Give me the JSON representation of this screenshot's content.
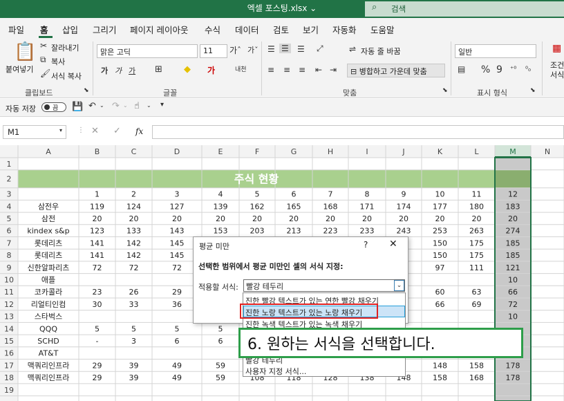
{
  "window": {
    "title": "엑셀 포스팅.xlsx ⌄",
    "search_placeholder": "검색"
  },
  "menu": [
    "파일",
    "홈",
    "삽입",
    "그리기",
    "페이지 레이아웃",
    "수식",
    "데이터",
    "검토",
    "보기",
    "자동화",
    "도움말"
  ],
  "ribbon": {
    "paste": "붙여넣기",
    "cut": "잘라내기",
    "copy": "복사",
    "format_painter": "서식 복사",
    "clipboard_group": "클립보드",
    "font_name": "맑은 고딕",
    "font_size": "11",
    "font_group": "글꼴",
    "wrap_text": "자동 줄 바꿈",
    "merge_center": "병합하고 가운데 맞춤",
    "align_group": "맞춤",
    "number_format": "일반",
    "number_group": "표시 형식",
    "conditional_1": "조건",
    "conditional_2": "서식"
  },
  "qat": {
    "autosave": "자동 저장",
    "toggle": "끔"
  },
  "formula_bar": {
    "name_box": "M1",
    "fx": "fx"
  },
  "sheet": {
    "columns": [
      "A",
      "B",
      "C",
      "D",
      "E",
      "F",
      "G",
      "H",
      "I",
      "J",
      "K",
      "L",
      "M",
      "N"
    ],
    "title": "주식 현황",
    "header_numbers": [
      "1",
      "2",
      "3",
      "4",
      "5",
      "6",
      "7",
      "8",
      "9",
      "10",
      "11",
      "12"
    ],
    "rows": [
      {
        "name": "삼전우",
        "v": [
          "119",
          "124",
          "127",
          "139",
          "162",
          "165",
          "168",
          "171",
          "174",
          "177",
          "180",
          "183"
        ]
      },
      {
        "name": "삼전",
        "v": [
          "20",
          "20",
          "20",
          "20",
          "20",
          "20",
          "20",
          "20",
          "20",
          "20",
          "20",
          "20"
        ]
      },
      {
        "name": "kindex s&p",
        "v": [
          "123",
          "133",
          "143",
          "153",
          "203",
          "213",
          "223",
          "233",
          "243",
          "253",
          "263",
          "274"
        ]
      },
      {
        "name": "롯데리츠",
        "v": [
          "141",
          "142",
          "145",
          "",
          "",
          "",
          "",
          "",
          "",
          "150",
          "175",
          "185"
        ]
      },
      {
        "name": "롯데리츠",
        "v": [
          "141",
          "142",
          "145",
          "",
          "",
          "",
          "",
          "",
          "",
          "150",
          "175",
          "185"
        ]
      },
      {
        "name": "신한알파리츠",
        "v": [
          "72",
          "72",
          "72",
          "",
          "",
          "",
          "",
          "",
          "",
          "97",
          "111",
          "121"
        ]
      },
      {
        "name": "애플",
        "v": [
          "",
          "",
          "",
          "",
          "",
          "",
          "",
          "",
          "",
          "",
          "",
          "10"
        ]
      },
      {
        "name": "코카콜라",
        "v": [
          "23",
          "26",
          "29",
          "",
          "",
          "",
          "",
          "",
          "",
          "60",
          "63",
          "66"
        ]
      },
      {
        "name": "리얼티인컴",
        "v": [
          "30",
          "33",
          "36",
          "",
          "",
          "",
          "",
          "",
          "",
          "66",
          "69",
          "72"
        ]
      },
      {
        "name": "스타벅스",
        "v": [
          "",
          "",
          "",
          "",
          "",
          "",
          "",
          "",
          "",
          "",
          "",
          "10"
        ]
      },
      {
        "name": "QQQ",
        "v": [
          "5",
          "5",
          "5",
          "5",
          "",
          "",
          "",
          "",
          "",
          "",
          "",
          ""
        ]
      },
      {
        "name": "SCHD",
        "v": [
          "-",
          "3",
          "6",
          "6",
          "",
          "",
          "",
          "",
          "",
          "",
          "",
          ""
        ]
      },
      {
        "name": "AT&T",
        "v": [
          "",
          "",
          "",
          "",
          "",
          "",
          "",
          "",
          "",
          "",
          "",
          ""
        ]
      },
      {
        "name": "맥쿼리인프라",
        "v": [
          "29",
          "39",
          "49",
          "59",
          "",
          "",
          "",
          "",
          "",
          "148",
          "158",
          "178"
        ]
      },
      {
        "name": "맥쿼리인프라",
        "v": [
          "29",
          "39",
          "49",
          "59",
          "108",
          "118",
          "128",
          "138",
          "148",
          "158",
          "168",
          "178"
        ]
      }
    ]
  },
  "dialog": {
    "title": "평균 미만",
    "help": "?",
    "close": "✕",
    "description": "선택한 범위에서 평균 미만인 셀의 서식 지정:",
    "label": "적용할 서식:",
    "selected": "빨강 테두리",
    "options": [
      "진한 빨강 텍스트가 있는 연한 빨강 채우기",
      "진한 노랑 텍스트가 있는 노랑 채우기",
      "진한 녹색 텍스트가 있는 녹색 채우기",
      "빨강 테두리",
      "사용자 지정 서식..."
    ]
  },
  "callout": "6. 원하는 서식을 선택합니다.",
  "colors": {
    "excel_green": "#217346",
    "title_fill": "#a9d08e",
    "selected_col": "#c9c9c9",
    "callout_border": "#2e9e4a"
  }
}
